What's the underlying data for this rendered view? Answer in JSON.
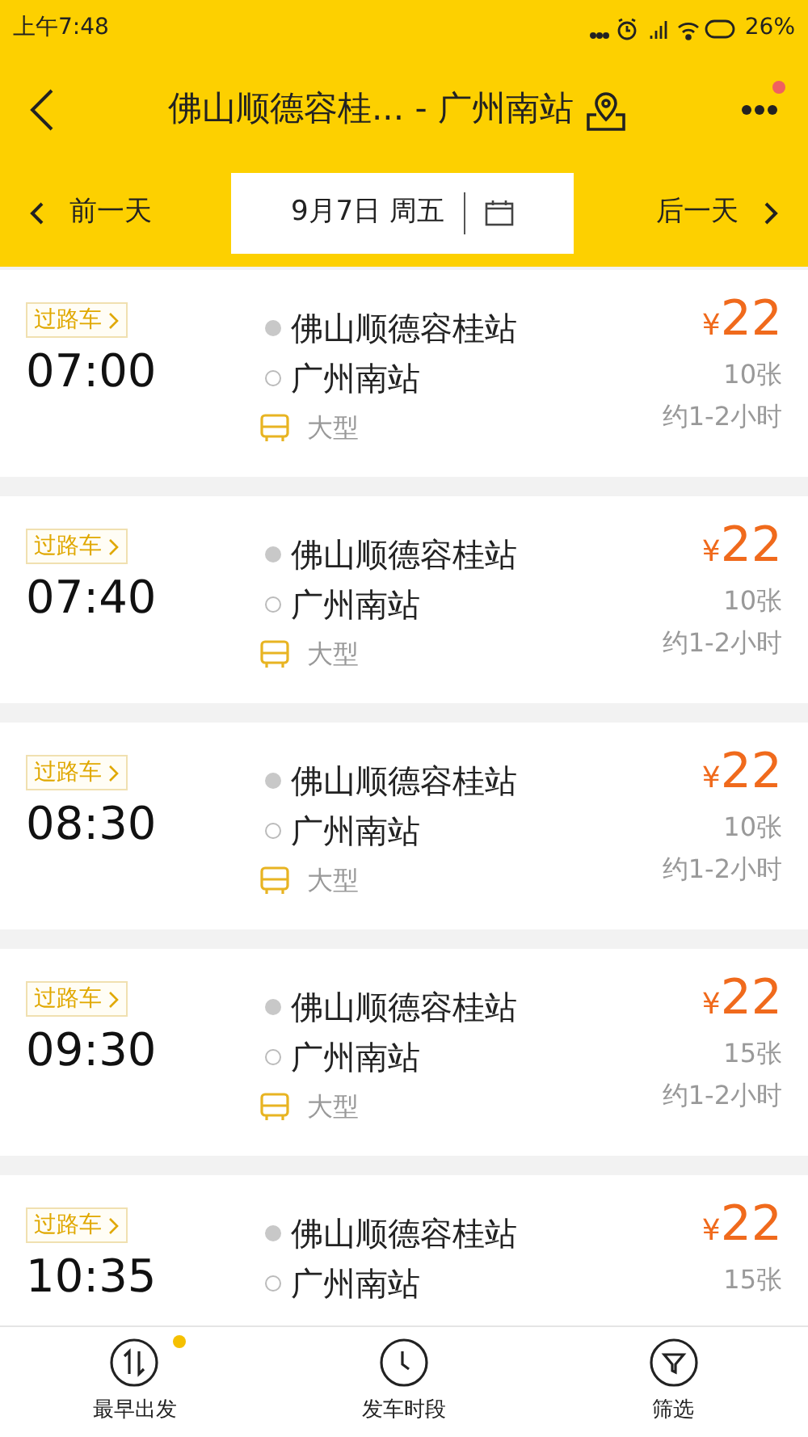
{
  "status_bar": {
    "time": "上午7:48",
    "battery": "26%"
  },
  "header": {
    "title": "佛山顺德容桂... - 广州南站",
    "menu_dot": true
  },
  "date_bar": {
    "prev": "前一天",
    "date": "9月7日 周五",
    "next": "后一天"
  },
  "trips": [
    {
      "tag": "过路车",
      "time": "07:00",
      "from": "佛山顺德容桂站",
      "to": "广州南站",
      "bus_type": "大型",
      "currency": "¥",
      "price": "22",
      "seats": "10张",
      "duration": "约1-2小时"
    },
    {
      "tag": "过路车",
      "time": "07:40",
      "from": "佛山顺德容桂站",
      "to": "广州南站",
      "bus_type": "大型",
      "currency": "¥",
      "price": "22",
      "seats": "10张",
      "duration": "约1-2小时"
    },
    {
      "tag": "过路车",
      "time": "08:30",
      "from": "佛山顺德容桂站",
      "to": "广州南站",
      "bus_type": "大型",
      "currency": "¥",
      "price": "22",
      "seats": "10张",
      "duration": "约1-2小时"
    },
    {
      "tag": "过路车",
      "time": "09:30",
      "from": "佛山顺德容桂站",
      "to": "广州南站",
      "bus_type": "大型",
      "currency": "¥",
      "price": "22",
      "seats": "15张",
      "duration": "约1-2小时"
    },
    {
      "tag": "过路车",
      "time": "10:35",
      "from": "佛山顺德容桂站",
      "to": "广州南站",
      "currency": "¥",
      "price": "22",
      "seats": "15张"
    }
  ],
  "bottom_nav": [
    {
      "kind": "sort",
      "label": "最早出发",
      "dot": true
    },
    {
      "kind": "clock",
      "label": "发车时段",
      "dot": false
    },
    {
      "kind": "filter",
      "label": "筛选",
      "dot": false
    }
  ]
}
